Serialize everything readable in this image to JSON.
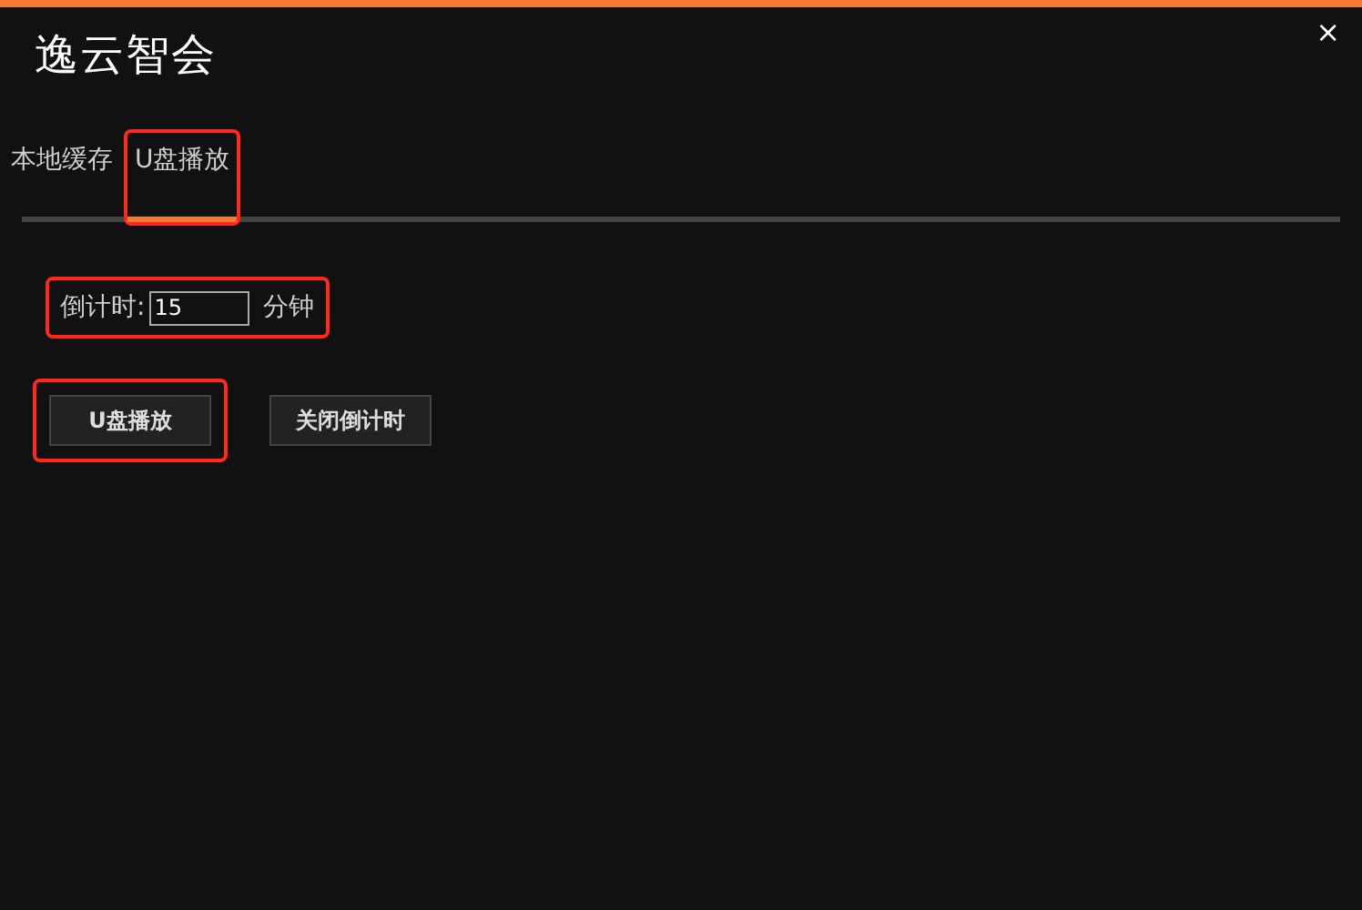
{
  "window": {
    "title": "逸云智会",
    "close": "×"
  },
  "tabs": [
    {
      "label": "本地缓存",
      "selected": false,
      "highlighted": false
    },
    {
      "label": "U盘播放",
      "selected": true,
      "highlighted": true
    }
  ],
  "countdown": {
    "label": "倒计时:",
    "value": "15",
    "unit": "分钟",
    "highlighted": true
  },
  "buttons": [
    {
      "label": "U盘播放",
      "highlighted": true
    },
    {
      "label": "关闭倒计时",
      "highlighted": false
    }
  ]
}
